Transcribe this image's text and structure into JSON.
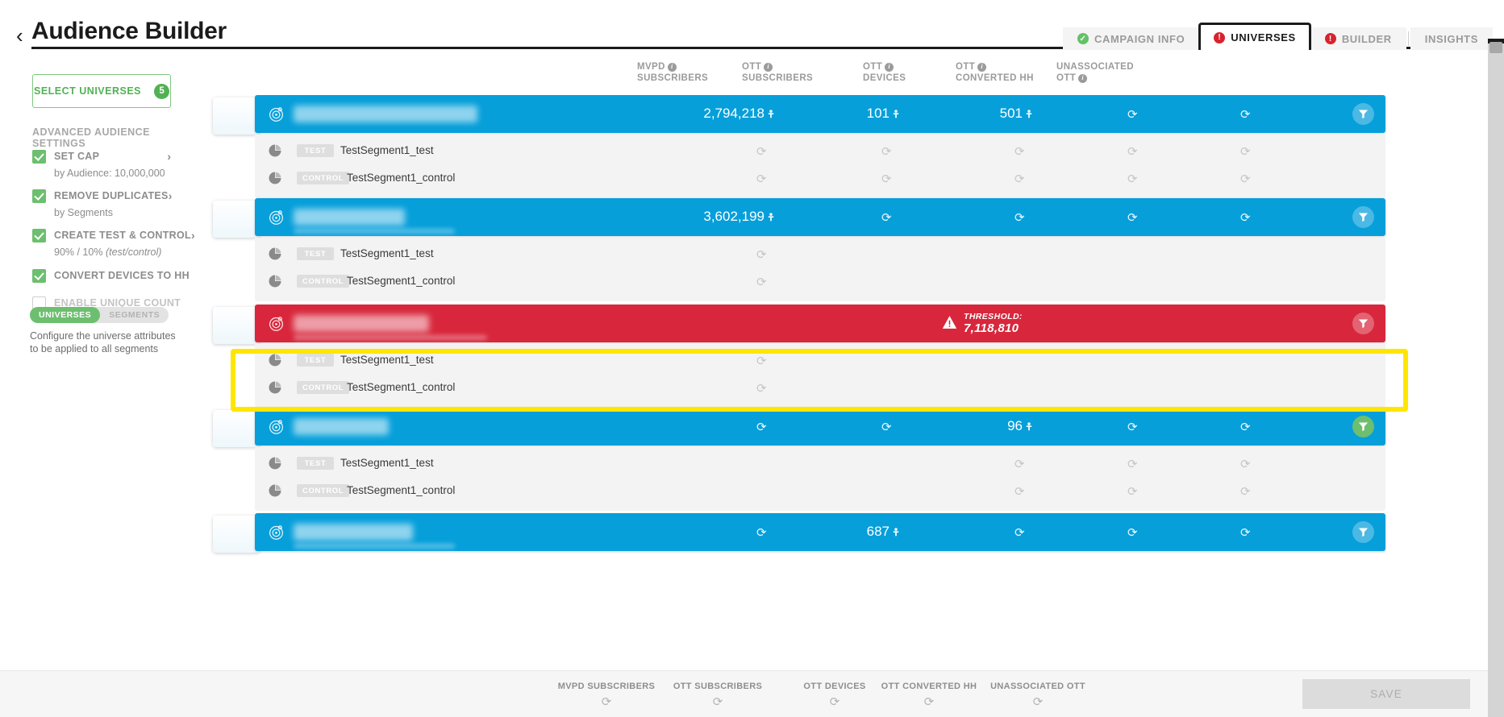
{
  "header": {
    "back_icon": "chevron-left-icon",
    "title": "Audience Builder"
  },
  "tabs": [
    {
      "label": "CAMPAIGN INFO",
      "status": "complete",
      "status_icon": "check-circle-icon",
      "active": false
    },
    {
      "label": "UNIVERSES",
      "status": "error",
      "status_icon": "error-circle-icon",
      "active": true
    },
    {
      "label": "BUILDER",
      "status": "error",
      "status_icon": "error-circle-icon",
      "active": false
    },
    {
      "label": "INSIGHTS",
      "status": "none",
      "status_icon": "",
      "active": false
    }
  ],
  "sidebar": {
    "select_universes": {
      "label": "SELECT UNIVERSES",
      "count": "5"
    },
    "advanced_heading": "ADVANCED AUDIENCE SETTINGS",
    "settings": [
      {
        "label": "SET CAP",
        "sub": "by Audience: 10,000,000",
        "sub_italic": "",
        "checked": true,
        "chevron": true,
        "enabled": true
      },
      {
        "label": "REMOVE DUPLICATES",
        "sub": "by Segments",
        "sub_italic": "",
        "checked": true,
        "chevron": true,
        "enabled": true
      },
      {
        "label": "CREATE TEST & CONTROL",
        "sub": "90% / 10% ",
        "sub_italic": "(test/control)",
        "checked": true,
        "chevron": true,
        "enabled": true
      },
      {
        "label": "CONVERT DEVICES TO HH",
        "sub": "",
        "sub_italic": "",
        "checked": true,
        "chevron": false,
        "enabled": true
      },
      {
        "label": "ENABLE UNIQUE COUNT",
        "sub": "",
        "sub_italic": "",
        "checked": false,
        "chevron": false,
        "enabled": false
      }
    ],
    "view_toggle": {
      "on": "UNIVERSES",
      "off": "SEGMENTS"
    },
    "description": "Configure the universe attributes to be applied to all segments"
  },
  "table": {
    "columns": [
      {
        "line1": "MVPD",
        "line2": "SUBSCRIBERS",
        "info": true,
        "info_on_line1": true
      },
      {
        "line1": "OTT",
        "line2": "SUBSCRIBERS",
        "info": true,
        "info_on_line1": true
      },
      {
        "line1": "OTT",
        "line2": "DEVICES",
        "info": true,
        "info_on_line1": true
      },
      {
        "line1": "OTT",
        "line2": "CONVERTED HH",
        "info": true,
        "info_on_line1": true
      },
      {
        "line1": "UNASSOCIATED",
        "line2": "OTT",
        "info": true,
        "info_on_line1": false
      }
    ],
    "spinner_glyph": "refresh-icon",
    "groups": [
      {
        "universe": {
          "name_redacted": true,
          "state": "normal",
          "filter_badge": "neutral",
          "values": {
            "mvpd_subscribers": "2,794,218",
            "ott_subscribers": "101",
            "ott_devices": "501",
            "ott_converted_hh": "",
            "unassociated_ott": ""
          }
        },
        "segments": [
          {
            "tag": "TEST",
            "name": "TestSegment1_test",
            "spinners": [
              "mvpd_subscribers",
              "ott_subscribers",
              "ott_devices",
              "ott_converted_hh",
              "unassociated_ott"
            ]
          },
          {
            "tag": "CONTROL",
            "name": "TestSegment1_control",
            "spinners": [
              "mvpd_subscribers",
              "ott_subscribers",
              "ott_devices",
              "ott_converted_hh",
              "unassociated_ott"
            ]
          }
        ]
      },
      {
        "universe": {
          "name_redacted": true,
          "state": "normal",
          "filter_badge": "neutral",
          "values": {
            "mvpd_subscribers": "3,602,199",
            "ott_subscribers": "",
            "ott_devices": "",
            "ott_converted_hh": "",
            "unassociated_ott": ""
          }
        },
        "segments": [
          {
            "tag": "TEST",
            "name": "TestSegment1_test",
            "spinners": [
              "mvpd_subscribers"
            ]
          },
          {
            "tag": "CONTROL",
            "name": "TestSegment1_control",
            "spinners": [
              "mvpd_subscribers"
            ]
          }
        ]
      },
      {
        "universe": {
          "name_redacted": true,
          "state": "alert",
          "filter_badge": "neutral",
          "threshold_label": "THRESHOLD:",
          "threshold_value": "7,118,810",
          "threshold_icon": "warning-triangle-icon",
          "values": {
            "mvpd_subscribers": "",
            "ott_subscribers": "",
            "ott_devices": "",
            "ott_converted_hh": "",
            "unassociated_ott": ""
          }
        },
        "segments": [
          {
            "tag": "TEST",
            "name": "TestSegment1_test",
            "spinners": [
              "mvpd_subscribers"
            ]
          },
          {
            "tag": "CONTROL",
            "name": "TestSegment1_control",
            "spinners": [
              "mvpd_subscribers"
            ]
          }
        ]
      },
      {
        "universe": {
          "name_redacted": true,
          "state": "normal",
          "filter_badge": "green",
          "values": {
            "mvpd_subscribers": "",
            "ott_subscribers": "",
            "ott_devices": "96",
            "ott_converted_hh": "",
            "unassociated_ott": ""
          }
        },
        "segments": [
          {
            "tag": "TEST",
            "name": "TestSegment1_test",
            "spinners": [
              "ott_devices",
              "ott_converted_hh",
              "unassociated_ott"
            ]
          },
          {
            "tag": "CONTROL",
            "name": "TestSegment1_control",
            "spinners": [
              "ott_devices",
              "ott_converted_hh",
              "unassociated_ott"
            ]
          }
        ]
      },
      {
        "universe": {
          "name_redacted": true,
          "state": "normal",
          "filter_badge": "neutral",
          "values": {
            "mvpd_subscribers": "",
            "ott_subscribers": "687",
            "ott_devices": "",
            "ott_converted_hh": "",
            "unassociated_ott": ""
          }
        },
        "segments": []
      }
    ]
  },
  "footer": {
    "totals": [
      {
        "label": "MVPD SUBSCRIBERS",
        "value": ""
      },
      {
        "label": "OTT SUBSCRIBERS",
        "value": ""
      },
      {
        "label": "OTT DEVICES",
        "value": ""
      },
      {
        "label": "OTT CONVERTED HH",
        "value": ""
      },
      {
        "label": "UNASSOCIATED OTT",
        "value": ""
      }
    ],
    "save_label": "SAVE"
  },
  "colors": {
    "brand_blue": "#069fda",
    "alert_red": "#d8273c",
    "green": "#6cbf6e",
    "highlight_yellow": "#ffe600"
  }
}
